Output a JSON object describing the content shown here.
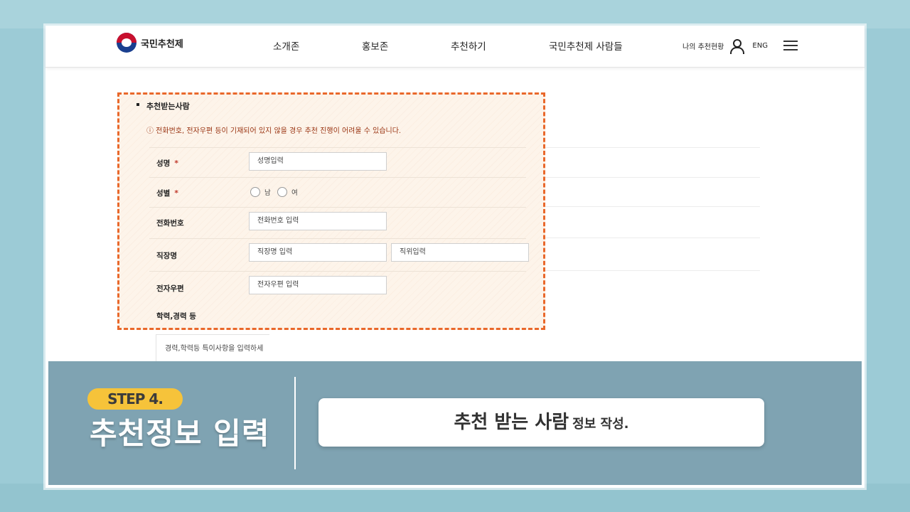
{
  "header": {
    "logo_text": "국민추천제",
    "nav": [
      "소개존",
      "홍보존",
      "추천하기",
      "국민추천제 사람들"
    ],
    "my_status": "나의 추천현황",
    "lang": "ENG"
  },
  "form": {
    "section_title": "추천받는사람",
    "notice": "ⓘ 전화번호, 전자우편 등이 기재되어 있지 않을 경우 추천 진행이 어려울 수 있습니다.",
    "required_mark": "*",
    "name_label": "성명",
    "name_placeholder": "성명입력",
    "gender_label": "성별",
    "gender_male": "남",
    "gender_female": "여",
    "phone_label": "전화번호",
    "phone_placeholder": "전화번호 입력",
    "work_label": "직장명",
    "work_placeholder": "직장명 입력",
    "position_placeholder": "직위입력",
    "email_label": "전자우편",
    "email_placeholder": "전자우편 입력",
    "career_label": "학력,경력 등",
    "career_placeholder": "경력,학력등 특이사항을 입력하세"
  },
  "banner": {
    "step": "STEP 4.",
    "title": "추천정보 입력",
    "caption_big": "추천 받는 사람",
    "caption_small": "정보 작성."
  },
  "colors": {
    "highlight_border": "#e9682b",
    "step_badge": "#f6c33a",
    "banner_bg": "#7fa3b2",
    "notice_text": "#9a3412"
  }
}
